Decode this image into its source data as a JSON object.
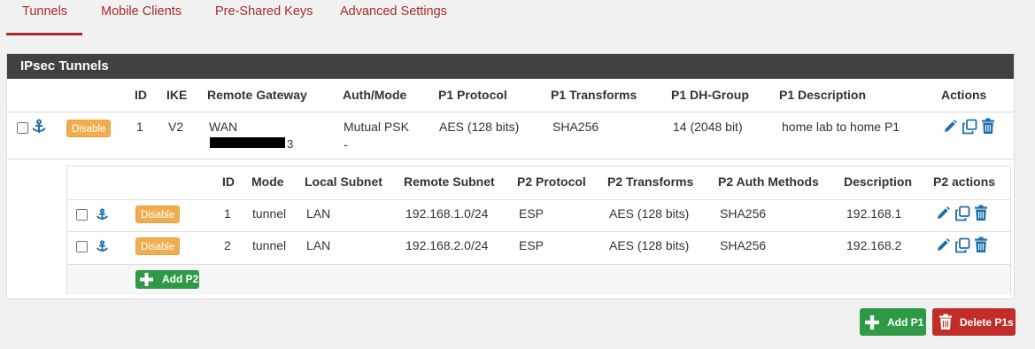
{
  "tabs": [
    {
      "label": "Tunnels",
      "active": true
    },
    {
      "label": "Mobile Clients",
      "active": false
    },
    {
      "label": "Pre-Shared Keys",
      "active": false
    },
    {
      "label": "Advanced Settings",
      "active": false
    }
  ],
  "panel": {
    "title": "IPsec Tunnels",
    "p1_headers": {
      "id": "ID",
      "ike": "IKE",
      "remote_gateway": "Remote Gateway",
      "auth_mode": "Auth/Mode",
      "p1_protocol": "P1 Protocol",
      "p1_transforms": "P1 Transforms",
      "p1_dh_group": "P1 DH-Group",
      "p1_description": "P1 Description",
      "actions": "Actions"
    },
    "p1_row": {
      "disable_label": "Disable",
      "id": "1",
      "ike": "V2",
      "remote_gateway": "WAN",
      "remote_gateway_ip_tail": "3",
      "auth_mode": "Mutual PSK",
      "auth_mode_sub": "-",
      "p1_protocol": "AES (128 bits)",
      "p1_transforms": "SHA256",
      "p1_dh_group": "14 (2048 bit)",
      "p1_description": "home lab to home P1"
    },
    "p2_headers": {
      "id": "ID",
      "mode": "Mode",
      "local_subnet": "Local Subnet",
      "remote_subnet": "Remote Subnet",
      "p2_protocol": "P2 Protocol",
      "p2_transforms": "P2 Transforms",
      "p2_auth_methods": "P2 Auth Methods",
      "description": "Description",
      "p2_actions": "P2 actions"
    },
    "p2_rows": [
      {
        "disable_label": "Disable",
        "id": "1",
        "mode": "tunnel",
        "local_subnet": "LAN",
        "remote_subnet": "192.168.1.0/24",
        "p2_protocol": "ESP",
        "p2_transforms": "AES (128 bits)",
        "p2_auth_methods": "SHA256",
        "description": "192.168.1"
      },
      {
        "disable_label": "Disable",
        "id": "2",
        "mode": "tunnel",
        "local_subnet": "LAN",
        "remote_subnet": "192.168.2.0/24",
        "p2_protocol": "ESP",
        "p2_transforms": "AES (128 bits)",
        "p2_auth_methods": "SHA256",
        "description": "192.168.2"
      }
    ],
    "add_p2_label": "Add P2"
  },
  "footer": {
    "add_p1_label": "Add P1",
    "delete_p1s_label": "Delete P1s"
  },
  "colors": {
    "accent": "#a82a2a",
    "panel_header": "#414141",
    "disable_button": "#f0ad4e",
    "success": "#2e9a45",
    "danger": "#c12e2a",
    "icon_blue": "#1e6fa9"
  },
  "icons": {
    "anchor": "anchor-icon",
    "edit": "pencil-icon",
    "copy": "copy-icon",
    "delete": "trash-icon",
    "add": "plus-icon"
  }
}
